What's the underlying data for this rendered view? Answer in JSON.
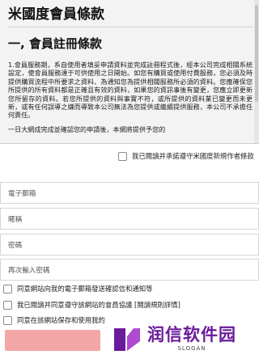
{
  "terms": {
    "title": "米國度會員條款",
    "section_title": "一, 會員註冊條款",
    "paragraph": "1.會員服務期，系自使用者填妥申請資料並完成註冊程式後，經本公司完成相關系統設定，使會員服務達于可供使用之日開始。如您有購買或使用付費服務，您必須及時提供購買流程中所要求之資料、為通知您為提供相關服務所必須的資料。您應確保您所提供的所有資料都是正確且有效的資料，如果您的資訊事後有變更，您應立即更新您所留存的資料。若您所提供的資料與事實不符，或所提供的資料業已變更而未更新，或有任何誤導之嫌而導致本公司無法為您提供或繼續提供服務，本公司不承擔任何責任。",
    "tail": "一日大網成完成並確認您的申請後，本網將提供予您的"
  },
  "agree_terms": {
    "label": "我已閱讀并承諾遵守米國度新規作者條款"
  },
  "form": {
    "email_placeholder": "電子郵箱",
    "nickname_placeholder": "暱稱",
    "password_placeholder": "密碼",
    "confirm_placeholder": "再次輸入密碼"
  },
  "options": {
    "notify_label": "同意網站向我的電子郵箱發送確認信和通知等",
    "protocol_label": "我已閱讀并同意遵守該網站的會員協議",
    "protocol_link": "[閱讀規則詳情]",
    "cookie_label": "同意在該網站保存和使用我的"
  },
  "watermark": {
    "title": "润信软件园",
    "slogan": "SLOGAN",
    "colors": {
      "primary": "#6a1b9a",
      "accent": "#b04ad0"
    }
  },
  "colors": {
    "submit": "#f3a6a6",
    "terms_bg": "#f3f3f3"
  }
}
